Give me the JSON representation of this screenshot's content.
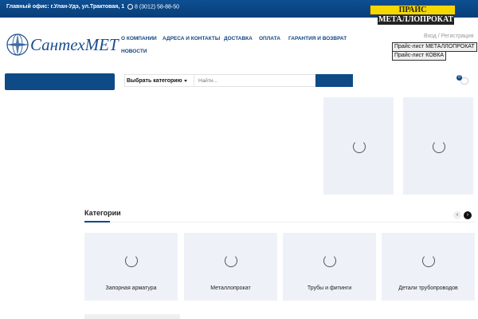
{
  "topbar": {
    "office": "Главный офис: г.Улан-Удэ, ул.Трактовая, 1",
    "phone": "8 (3012) 58-88-50"
  },
  "price_banner": {
    "line1": "ПРАЙС",
    "line2": "МЕТАЛЛОПРОКАТ"
  },
  "logo": {
    "text": "СантехМЕТ"
  },
  "nav": {
    "items": [
      "О компании",
      "Адреса и контакты",
      "Доставка",
      "Оплата",
      "Гарантия и возврат",
      "Новости"
    ]
  },
  "account": {
    "login": "Вход / Регистрация"
  },
  "price_lists": {
    "metal": "Прайс-лист МЕТАЛЛОПРОКАТ",
    "forging": "Прайс-лист КОВКА"
  },
  "search": {
    "category_label": "Выбрать категорию",
    "placeholder": "Найти..."
  },
  "cart": {
    "count": "0"
  },
  "categories": {
    "title": "Категории",
    "prev_icon": "‹",
    "next_icon": "›",
    "items": [
      "Запорная арматура",
      "Металлопрокат",
      "Трубы и фитинги",
      "Детали трубопроводов"
    ]
  },
  "colors": {
    "brand": "#0e4a86",
    "accent": "#f5d800",
    "card_bg": "#eef2f8"
  }
}
